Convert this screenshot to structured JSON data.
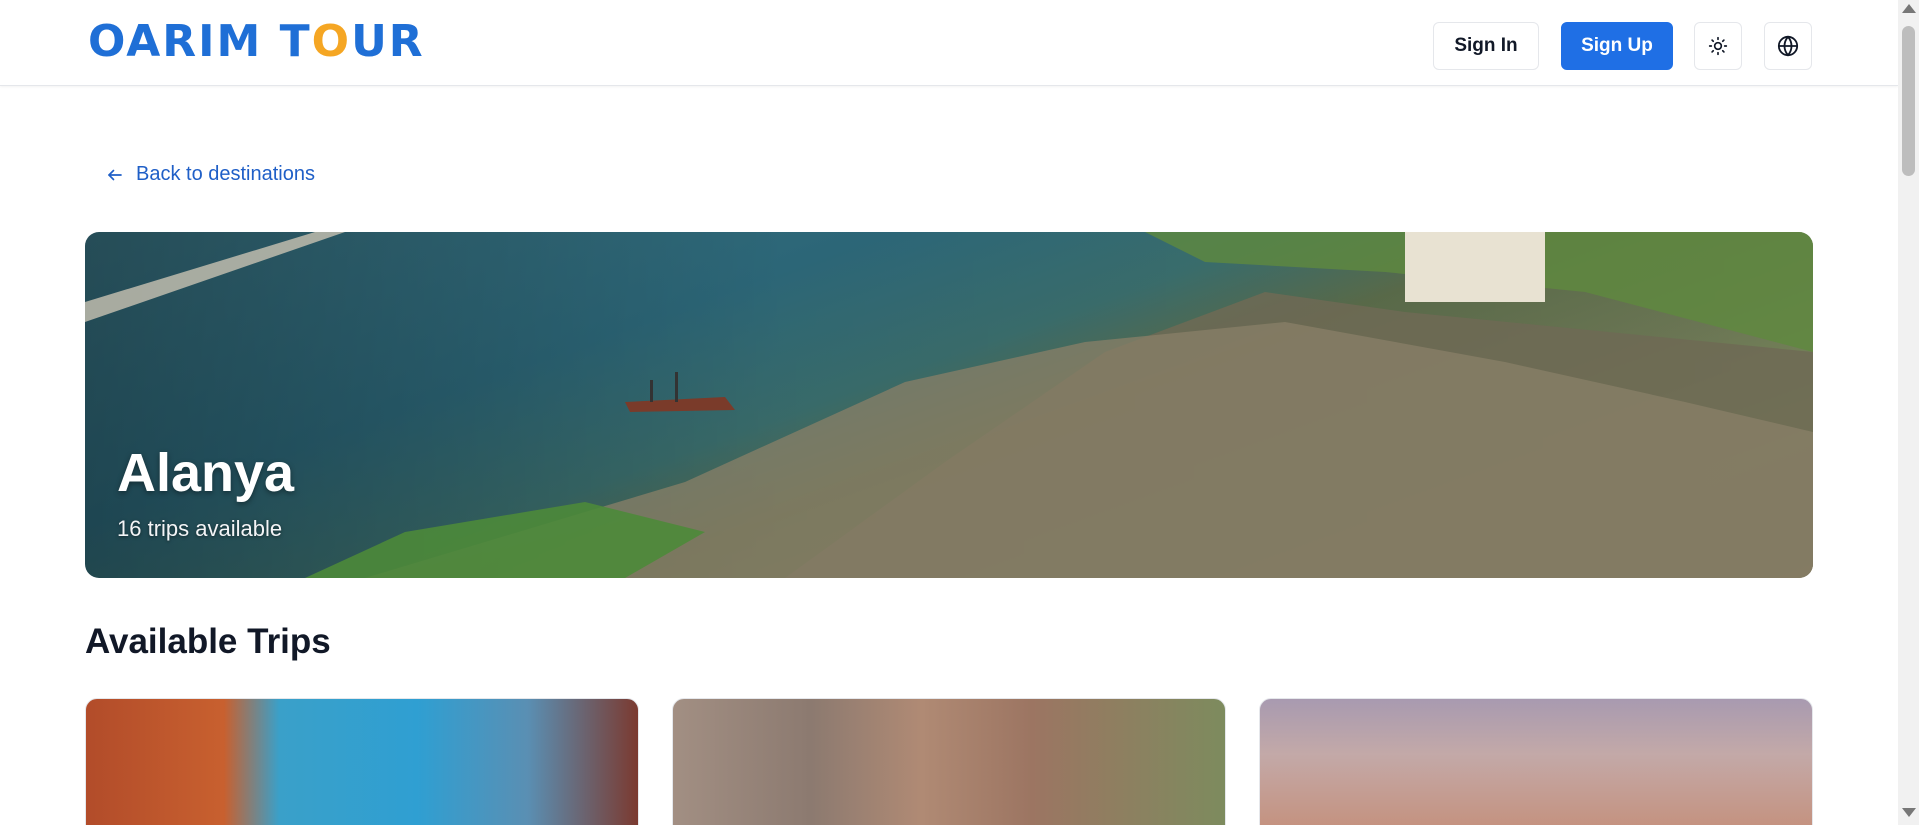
{
  "header": {
    "logo_text_a": "OARI",
    "logo_text_b": "M T",
    "logo_text_sun": "O",
    "logo_text_c": "UR",
    "sign_in_label": "Sign In",
    "sign_up_label": "Sign Up",
    "theme_icon": "sun-icon",
    "language_icon": "globe-icon"
  },
  "nav": {
    "back_label": "Back to destinations",
    "back_icon": "arrow-left-icon"
  },
  "hero": {
    "title": "Alanya",
    "subtitle": "16 trips available"
  },
  "trips": {
    "section_title": "Available Trips"
  },
  "colors": {
    "primary": "#1f6fe5",
    "link": "#1f5fc7",
    "logo_blue": "#1f6fd6",
    "logo_orange": "#f5a623"
  }
}
